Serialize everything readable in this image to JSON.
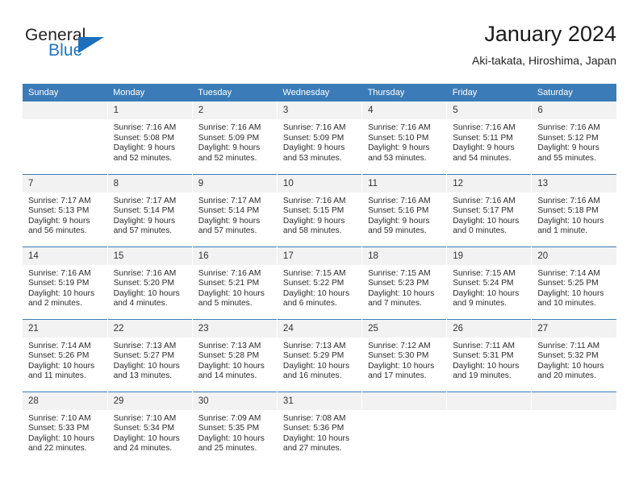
{
  "brand": {
    "word_top": "General",
    "word_bottom": "Blue",
    "accent_color": "#1b77c4",
    "triangle_color": "#1b6fbb"
  },
  "header": {
    "title": "January 2024",
    "subtitle": "Aki-takata, Hiroshima, Japan"
  },
  "calendar": {
    "header_bg": "#3b7cb8",
    "daynum_bg": "#f2f2f2",
    "weekday_headers": [
      "Sunday",
      "Monday",
      "Tuesday",
      "Wednesday",
      "Thursday",
      "Friday",
      "Saturday"
    ],
    "weeks": [
      [
        {
          "day": "",
          "detail": ""
        },
        {
          "day": "1",
          "detail": "Sunrise: 7:16 AM\nSunset: 5:08 PM\nDaylight: 9 hours\nand 52 minutes."
        },
        {
          "day": "2",
          "detail": "Sunrise: 7:16 AM\nSunset: 5:09 PM\nDaylight: 9 hours\nand 52 minutes."
        },
        {
          "day": "3",
          "detail": "Sunrise: 7:16 AM\nSunset: 5:09 PM\nDaylight: 9 hours\nand 53 minutes."
        },
        {
          "day": "4",
          "detail": "Sunrise: 7:16 AM\nSunset: 5:10 PM\nDaylight: 9 hours\nand 53 minutes."
        },
        {
          "day": "5",
          "detail": "Sunrise: 7:16 AM\nSunset: 5:11 PM\nDaylight: 9 hours\nand 54 minutes."
        },
        {
          "day": "6",
          "detail": "Sunrise: 7:16 AM\nSunset: 5:12 PM\nDaylight: 9 hours\nand 55 minutes."
        }
      ],
      [
        {
          "day": "7",
          "detail": "Sunrise: 7:17 AM\nSunset: 5:13 PM\nDaylight: 9 hours\nand 56 minutes."
        },
        {
          "day": "8",
          "detail": "Sunrise: 7:17 AM\nSunset: 5:14 PM\nDaylight: 9 hours\nand 57 minutes."
        },
        {
          "day": "9",
          "detail": "Sunrise: 7:17 AM\nSunset: 5:14 PM\nDaylight: 9 hours\nand 57 minutes."
        },
        {
          "day": "10",
          "detail": "Sunrise: 7:16 AM\nSunset: 5:15 PM\nDaylight: 9 hours\nand 58 minutes."
        },
        {
          "day": "11",
          "detail": "Sunrise: 7:16 AM\nSunset: 5:16 PM\nDaylight: 9 hours\nand 59 minutes."
        },
        {
          "day": "12",
          "detail": "Sunrise: 7:16 AM\nSunset: 5:17 PM\nDaylight: 10 hours\nand 0 minutes."
        },
        {
          "day": "13",
          "detail": "Sunrise: 7:16 AM\nSunset: 5:18 PM\nDaylight: 10 hours\nand 1 minute."
        }
      ],
      [
        {
          "day": "14",
          "detail": "Sunrise: 7:16 AM\nSunset: 5:19 PM\nDaylight: 10 hours\nand 2 minutes."
        },
        {
          "day": "15",
          "detail": "Sunrise: 7:16 AM\nSunset: 5:20 PM\nDaylight: 10 hours\nand 4 minutes."
        },
        {
          "day": "16",
          "detail": "Sunrise: 7:16 AM\nSunset: 5:21 PM\nDaylight: 10 hours\nand 5 minutes."
        },
        {
          "day": "17",
          "detail": "Sunrise: 7:15 AM\nSunset: 5:22 PM\nDaylight: 10 hours\nand 6 minutes."
        },
        {
          "day": "18",
          "detail": "Sunrise: 7:15 AM\nSunset: 5:23 PM\nDaylight: 10 hours\nand 7 minutes."
        },
        {
          "day": "19",
          "detail": "Sunrise: 7:15 AM\nSunset: 5:24 PM\nDaylight: 10 hours\nand 9 minutes."
        },
        {
          "day": "20",
          "detail": "Sunrise: 7:14 AM\nSunset: 5:25 PM\nDaylight: 10 hours\nand 10 minutes."
        }
      ],
      [
        {
          "day": "21",
          "detail": "Sunrise: 7:14 AM\nSunset: 5:26 PM\nDaylight: 10 hours\nand 11 minutes."
        },
        {
          "day": "22",
          "detail": "Sunrise: 7:13 AM\nSunset: 5:27 PM\nDaylight: 10 hours\nand 13 minutes."
        },
        {
          "day": "23",
          "detail": "Sunrise: 7:13 AM\nSunset: 5:28 PM\nDaylight: 10 hours\nand 14 minutes."
        },
        {
          "day": "24",
          "detail": "Sunrise: 7:13 AM\nSunset: 5:29 PM\nDaylight: 10 hours\nand 16 minutes."
        },
        {
          "day": "25",
          "detail": "Sunrise: 7:12 AM\nSunset: 5:30 PM\nDaylight: 10 hours\nand 17 minutes."
        },
        {
          "day": "26",
          "detail": "Sunrise: 7:11 AM\nSunset: 5:31 PM\nDaylight: 10 hours\nand 19 minutes."
        },
        {
          "day": "27",
          "detail": "Sunrise: 7:11 AM\nSunset: 5:32 PM\nDaylight: 10 hours\nand 20 minutes."
        }
      ],
      [
        {
          "day": "28",
          "detail": "Sunrise: 7:10 AM\nSunset: 5:33 PM\nDaylight: 10 hours\nand 22 minutes."
        },
        {
          "day": "29",
          "detail": "Sunrise: 7:10 AM\nSunset: 5:34 PM\nDaylight: 10 hours\nand 24 minutes."
        },
        {
          "day": "30",
          "detail": "Sunrise: 7:09 AM\nSunset: 5:35 PM\nDaylight: 10 hours\nand 25 minutes."
        },
        {
          "day": "31",
          "detail": "Sunrise: 7:08 AM\nSunset: 5:36 PM\nDaylight: 10 hours\nand 27 minutes."
        },
        {
          "day": "",
          "detail": ""
        },
        {
          "day": "",
          "detail": ""
        },
        {
          "day": "",
          "detail": ""
        }
      ]
    ]
  }
}
